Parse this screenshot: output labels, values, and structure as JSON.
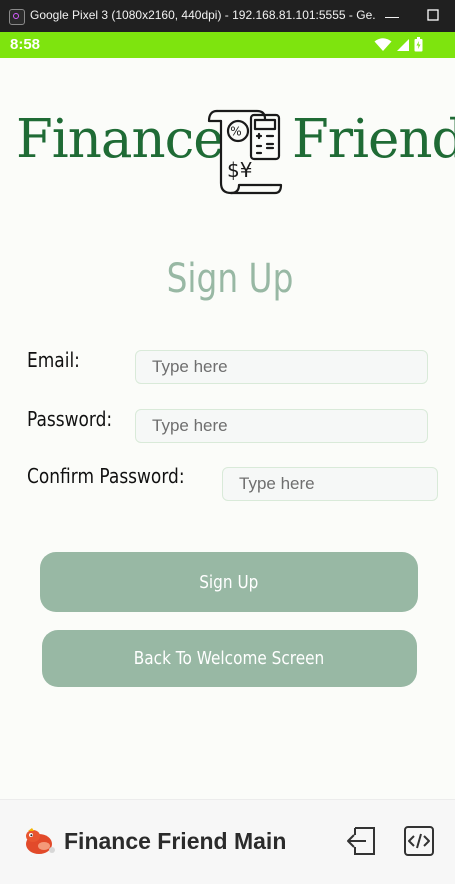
{
  "window": {
    "title": "Google Pixel 3 (1080x2160, 440dpi) - 192.168.81.101:5555 - Ge...",
    "minimize_icon": "minimize-icon",
    "maximize_icon": "maximize-icon"
  },
  "statusbar": {
    "time": "8:58",
    "icons": [
      "wifi-icon",
      "signal-icon",
      "battery-icon"
    ],
    "color": "#7ee40e"
  },
  "logo": {
    "left_word": "Finance",
    "right_word": "Friend",
    "icon": "receipt-calculator-icon",
    "receipt_symbols": "$¥",
    "color": "#1f6b35"
  },
  "page": {
    "heading": "Sign Up",
    "accent_color": "#98b8a4"
  },
  "form": {
    "email_label": "Email:",
    "email_placeholder": "Type here",
    "password_label": "Password:",
    "password_placeholder": "Type here",
    "confirm_label": "Confirm Password:",
    "confirm_placeholder": "Type here"
  },
  "buttons": {
    "signup": "Sign Up",
    "back": "Back To Welcome Screen"
  },
  "bottombar": {
    "app_name": "Finance Friend Main",
    "logo_icon": "app-mascot-icon",
    "tools": [
      "exit-icon",
      "code-icon"
    ]
  }
}
